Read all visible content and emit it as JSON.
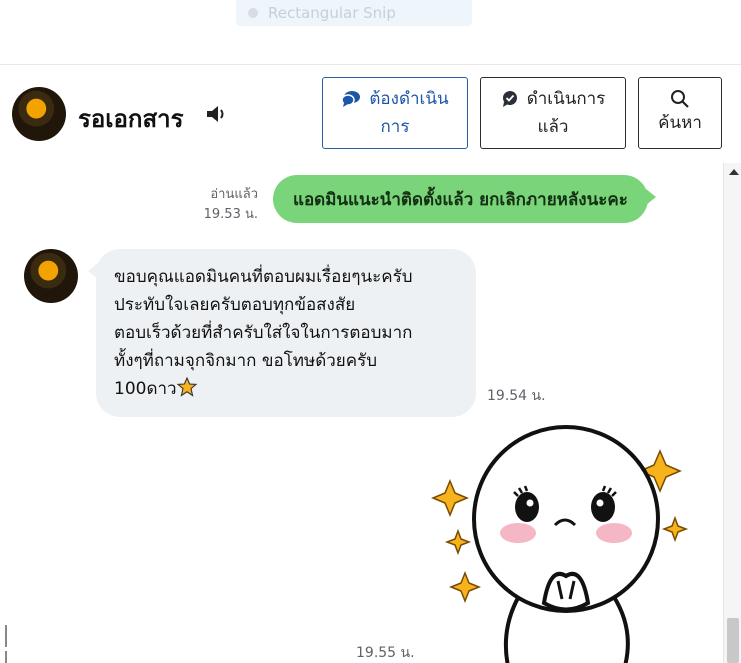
{
  "snip": {
    "label": "Rectangular Snip"
  },
  "header": {
    "title": "รอเอกสาร",
    "buttons": {
      "todo": {
        "line1": "ต้องดำเนิน",
        "line2": "การ"
      },
      "done": {
        "line1": "ดำเนินการ",
        "line2": "แล้ว"
      },
      "search": {
        "label": "ค้นหา"
      }
    }
  },
  "messages": [
    {
      "direction": "out",
      "text": "แอดมินแนะนำติดตั้งแล้ว ยกเลิกภายหลังนะคะ",
      "read": "อ่านแล้ว",
      "time": "19.53 น."
    },
    {
      "direction": "in",
      "text": "ขอบคุณแอดมินคนที่ตอบผมเรื่อยๆนะครับ\nประทับใจเลยครับตอบทุกข้อสงสัย\nตอบเร็วด้วยที่สำครับใส่ใจในการตอบมาก\nทั้งๆที่ถามจุกจิกมาก ขอโทษด้วยครับ\n100ดาว",
      "time": "19.54 น."
    },
    {
      "direction": "in",
      "type": "sticker",
      "time": "19.55 น."
    }
  ],
  "colors": {
    "accent_blue": "#1d56a8",
    "outgoing_bubble": "#7ad47a",
    "incoming_bubble": "#eef1f4",
    "star": "#f6b31b"
  },
  "icons": [
    "speaker-icon",
    "todo-chat-icon",
    "done-chat-icon",
    "search-icon",
    "star-emoji-icon"
  ]
}
